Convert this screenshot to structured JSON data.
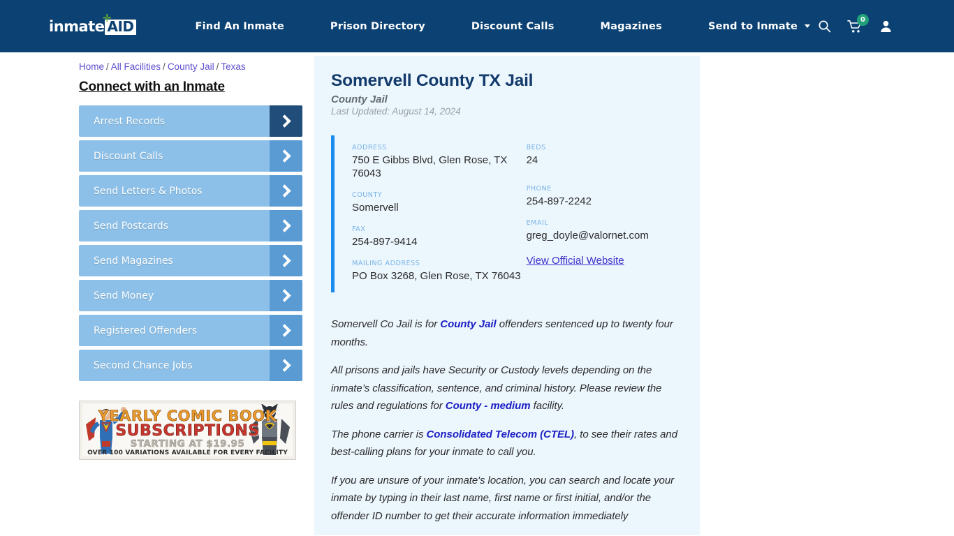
{
  "header": {
    "logo": {
      "part1": "inmate",
      "part2": "AID",
      "plus": "✛"
    },
    "nav": [
      {
        "label": "Find An Inmate",
        "dropdown": false
      },
      {
        "label": "Prison Directory",
        "dropdown": false
      },
      {
        "label": "Discount Calls",
        "dropdown": false
      },
      {
        "label": "Magazines",
        "dropdown": false
      },
      {
        "label": "Send to Inmate",
        "dropdown": true
      }
    ],
    "icons": {
      "search": "search-icon",
      "cart": "cart-icon",
      "cart_count": "0",
      "account": "user-icon"
    },
    "colors": {
      "background": "#0c4273",
      "badge": "#21a179",
      "logo_plus": "#76bc21"
    }
  },
  "breadcrumb": {
    "items": [
      "Home",
      "All Facilities",
      "County Jail",
      "Texas"
    ],
    "separator": "/"
  },
  "sidebar": {
    "title": "Connect with an Inmate",
    "items": [
      {
        "label": "Arrest Records",
        "active": true
      },
      {
        "label": "Discount Calls",
        "active": false
      },
      {
        "label": "Send Letters & Photos",
        "active": false
      },
      {
        "label": "Send Postcards",
        "active": false
      },
      {
        "label": "Send Magazines",
        "active": false
      },
      {
        "label": "Send Money",
        "active": false
      },
      {
        "label": "Registered Offenders",
        "active": false
      },
      {
        "label": "Second Chance Jobs",
        "active": false
      }
    ],
    "ad": {
      "line1": "YEARLY COMIC BOOK",
      "line2": "SUBSCRIPTIONS",
      "line3": "STARTING AT $19.95",
      "line4": "OVER 100 VARIATIONS AVAILABLE FOR EVERY FACILITY"
    }
  },
  "facility": {
    "title": "Somervell County TX Jail",
    "type": "County Jail",
    "last_updated": "Last Updated: August 14, 2024",
    "info_left": [
      {
        "label": "ADDRESS",
        "value": "750 E Gibbs Blvd, Glen Rose, TX 76043"
      },
      {
        "label": "COUNTY",
        "value": "Somervell"
      },
      {
        "label": "FAX",
        "value": "254-897-9414"
      },
      {
        "label": "MAILING ADDRESS",
        "value": "PO Box 3268, Glen Rose, TX 76043"
      }
    ],
    "info_right": [
      {
        "label": "BEDS",
        "value": "24"
      },
      {
        "label": "PHONE",
        "value": "254-897-2242"
      },
      {
        "label": "EMAIL",
        "value": "greg_doyle@valornet.com"
      }
    ],
    "official_website_link": "View Official Website"
  },
  "paragraphs": [
    {
      "parts": [
        {
          "t": "Somervell Co Jail is for ",
          "b": false
        },
        {
          "t": "County Jail",
          "b": true
        },
        {
          "t": " offenders sentenced up to twenty four months.",
          "b": false
        }
      ]
    },
    {
      "parts": [
        {
          "t": "All prisons and jails have Security or Custody levels depending on the inmate’s classification, sentence, and criminal history. Please review the rules and regulations for ",
          "b": false
        },
        {
          "t": "County - medium",
          "b": true
        },
        {
          "t": " facility.",
          "b": false
        }
      ]
    },
    {
      "parts": [
        {
          "t": "The phone carrier is ",
          "b": false
        },
        {
          "t": "Consolidated Telecom (CTEL)",
          "b": true
        },
        {
          "t": ", to see their rates and best-calling plans for your inmate to call you.",
          "b": false
        }
      ]
    },
    {
      "parts": [
        {
          "t": "If you are unsure of your inmate's location, you can search and locate your inmate by typing in their last name, first name or first initial, and/or the offender ID number to get their accurate information immediately",
          "b": false
        }
      ]
    }
  ]
}
